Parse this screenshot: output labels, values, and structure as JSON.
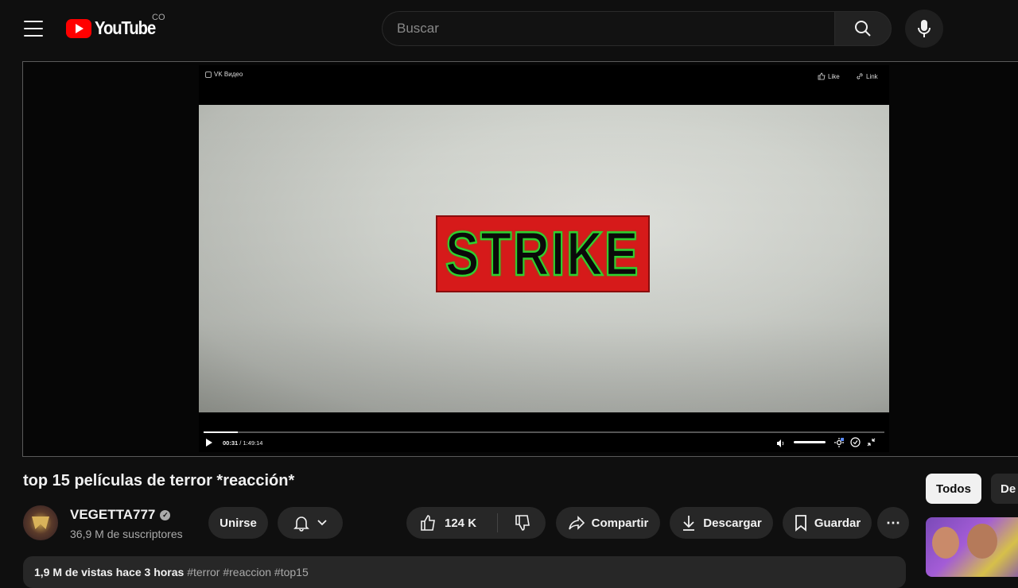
{
  "header": {
    "logo_text": "YouTube",
    "region": "CO",
    "search_placeholder": "Buscar"
  },
  "player": {
    "vk_brand": "VK Видео",
    "like_label": "Like",
    "link_label": "Link",
    "overlay_text": "STRIKE",
    "current_time": "00:31",
    "duration": "/ 1:49:14",
    "progress": 0.005
  },
  "video": {
    "title": "top 15 películas de terror *reacción*",
    "channel_name": "VEGETTA777",
    "subscribers": "36,9 M de suscriptores",
    "join_label": "Unirse",
    "likes": "124 K",
    "share_label": "Compartir",
    "download_label": "Descargar",
    "save_label": "Guardar",
    "more_label": "⋯",
    "desc_stats": "1,9 M de vistas  hace 3 horas",
    "desc_tags": "#terror #reaccion #top15"
  },
  "sidebar": {
    "chips": [
      "Todos",
      "De"
    ]
  },
  "colors": {
    "background": "#0f0f0f",
    "youtube_red": "#ff0000",
    "strike_red": "#d61a1a",
    "strike_green": "#2fd12f"
  }
}
